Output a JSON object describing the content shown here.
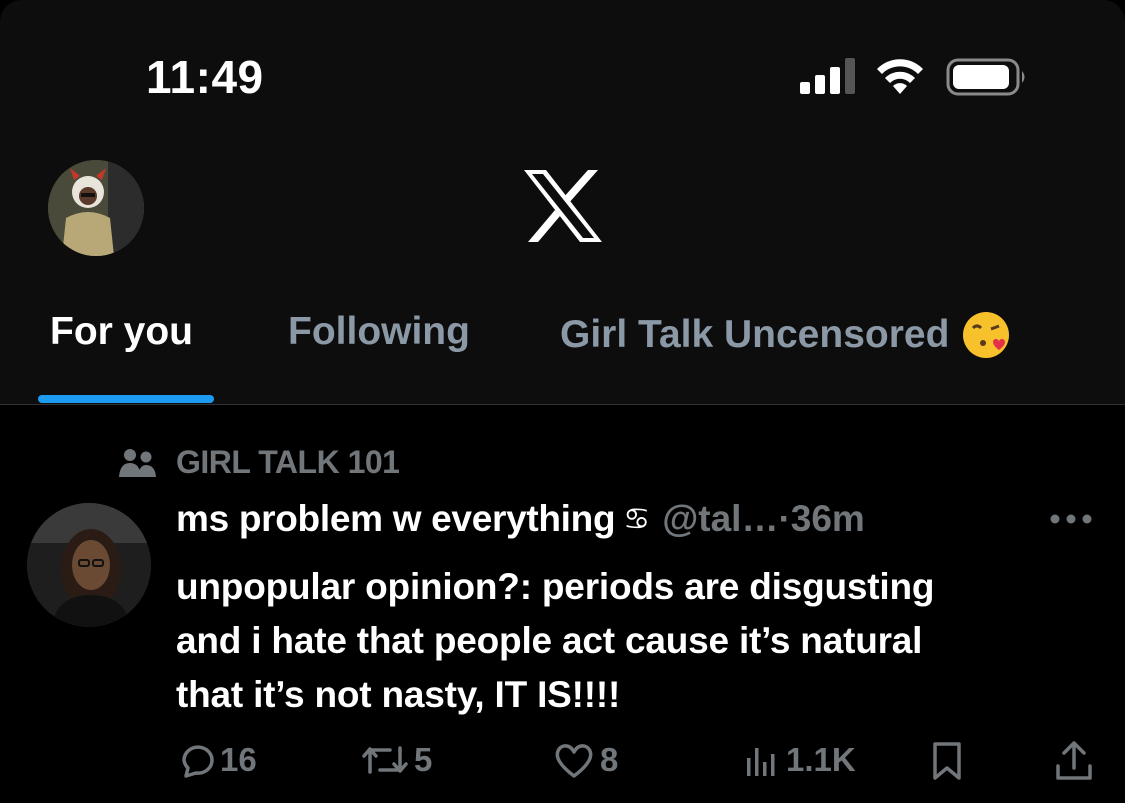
{
  "status_bar": {
    "time": "11:49"
  },
  "header": {
    "logo": "x-logo",
    "profile_avatar": "profile-avatar"
  },
  "tabs": [
    {
      "label": "For you",
      "active": true
    },
    {
      "label": "Following",
      "active": false
    },
    {
      "label": "Girl Talk Uncensored",
      "emoji": "face-blowing-kiss",
      "active": false
    }
  ],
  "post": {
    "community": "GIRL TALK 101",
    "author": "ms problem w everything",
    "author_badge": "♋",
    "handle": "@tal…",
    "time_sep": " · ",
    "time": "36m",
    "text_lines": [
      "unpopular opinion?: periods are disgusting",
      "and i hate that people act cause it’s natural",
      "that it’s not nasty, IT IS!!!!"
    ],
    "stats": {
      "replies": "16",
      "reposts": "5",
      "likes": "8",
      "views": "1.1K"
    }
  },
  "colors": {
    "accent": "#1d9bf0",
    "muted": "#71767b",
    "inactive_tab": "#8b98a5"
  }
}
